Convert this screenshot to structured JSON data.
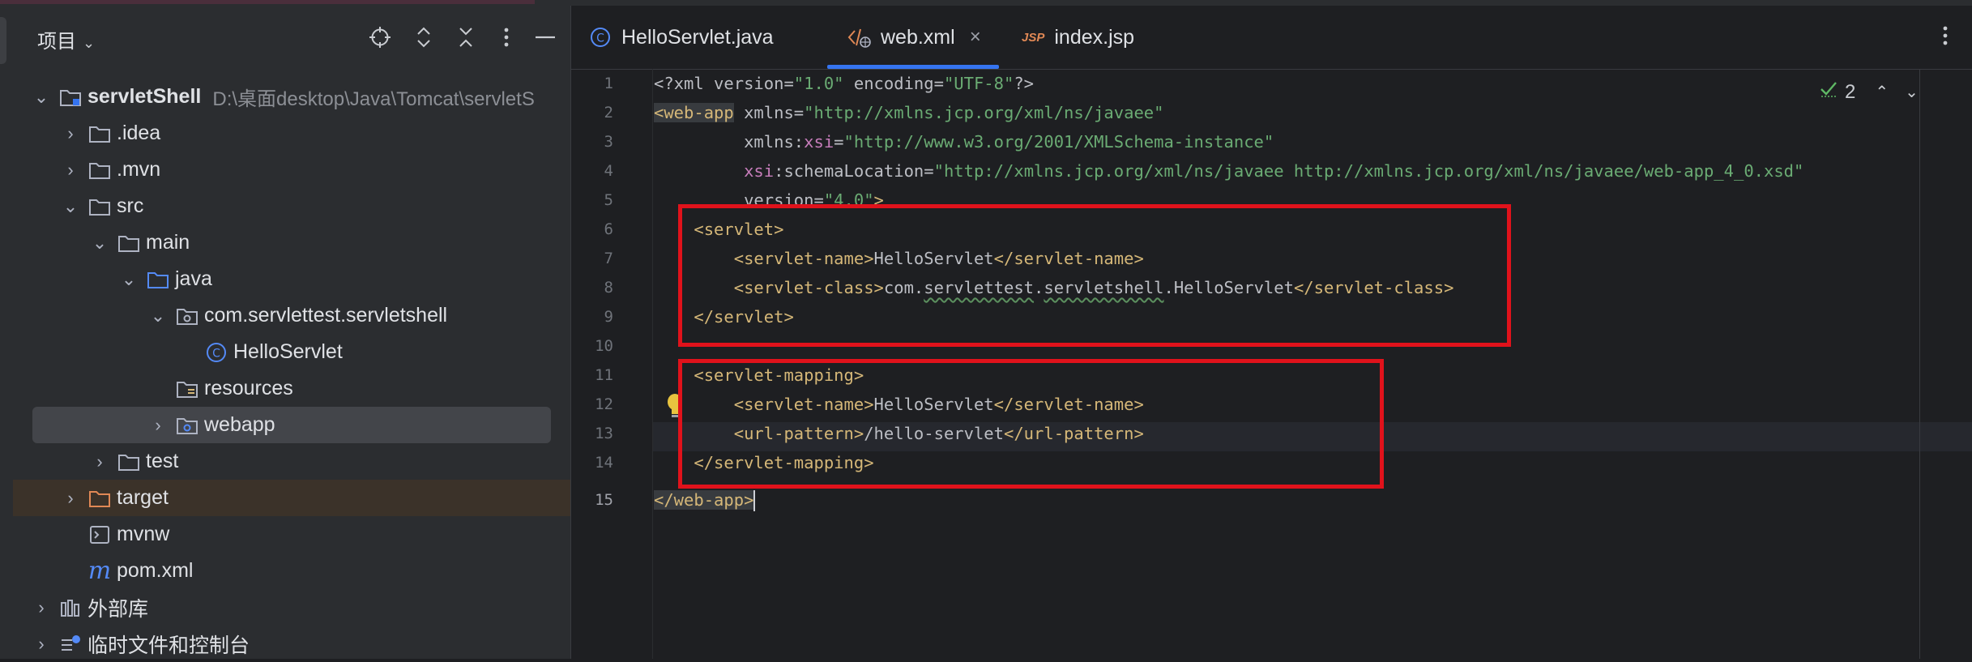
{
  "project_panel": {
    "title": "项目",
    "tree": [
      {
        "label": "servletShell",
        "path": "D:\\桌面desktop\\Java\\Tomcat\\servletS",
        "icon": "module-folder-icon",
        "expanded": true
      },
      {
        "label": ".idea",
        "icon": "folder-icon",
        "expanded": false
      },
      {
        "label": ".mvn",
        "icon": "folder-icon",
        "expanded": false
      },
      {
        "label": "src",
        "icon": "folder-icon",
        "expanded": true
      },
      {
        "label": "main",
        "icon": "folder-icon",
        "expanded": true
      },
      {
        "label": "java",
        "icon": "source-folder-icon",
        "expanded": true
      },
      {
        "label": "com.servlettest.servletshell",
        "icon": "package-icon",
        "expanded": true
      },
      {
        "label": "HelloServlet",
        "icon": "class-icon"
      },
      {
        "label": "resources",
        "icon": "resources-folder-icon"
      },
      {
        "label": "webapp",
        "icon": "web-folder-icon",
        "expanded": false,
        "selected": true
      },
      {
        "label": "test",
        "icon": "folder-icon",
        "expanded": false
      },
      {
        "label": "target",
        "icon": "excluded-folder-icon",
        "expanded": false
      },
      {
        "label": "mvnw",
        "icon": "terminal-file-icon"
      },
      {
        "label": "pom.xml",
        "icon": "maven-icon"
      },
      {
        "label": "外部库",
        "icon": "library-icon",
        "expanded": false
      },
      {
        "label": "临时文件和控制台",
        "icon": "scratches-icon",
        "expanded": false
      }
    ]
  },
  "editor": {
    "tabs": [
      {
        "label": "HelloServlet.java",
        "icon": "class-icon",
        "active": false
      },
      {
        "label": "web.xml",
        "icon": "xml-icon",
        "active": true,
        "close": "×"
      },
      {
        "label": "index.jsp",
        "icon": "jsp-icon",
        "active": false,
        "icon_text": "JSP"
      }
    ],
    "inspection": {
      "count": "2",
      "icon": "check-icon"
    },
    "current_line": 15,
    "line_numbers": [
      "1",
      "2",
      "3",
      "4",
      "5",
      "6",
      "7",
      "8",
      "9",
      "10",
      "11",
      "12",
      "13",
      "14",
      "15"
    ],
    "lines": [
      "<?xml version=\"1.0\" encoding=\"UTF-8\"?>",
      "<web-app xmlns=\"http://xmlns.jcp.org/xml/ns/javaee\"",
      "         xmlns:xsi=\"http://www.w3.org/2001/XMLSchema-instance\"",
      "         xsi:schemaLocation=\"http://xmlns.jcp.org/xml/ns/javaee http://xmlns.jcp.org/xml/ns/javaee/web-app_4_0.xsd\"",
      "         version=\"4.0\">",
      "    <servlet>",
      "        <servlet-name>HelloServlet</servlet-name>",
      "        <servlet-class>com.servlettest.servletshell.HelloServlet</servlet-class>",
      "    </servlet>",
      "",
      "    <servlet-mapping>",
      "        <servlet-name>HelloServlet</servlet-name>",
      "        <url-pattern>/hello-servlet</url-pattern>",
      "    </servlet-mapping>",
      "</web-app>"
    ]
  },
  "colors": {
    "tag": "#d5b778",
    "string": "#6aab73",
    "namespace": "#c77dbb",
    "accent": "#3574f0",
    "highlight_box": "#e0121b"
  }
}
